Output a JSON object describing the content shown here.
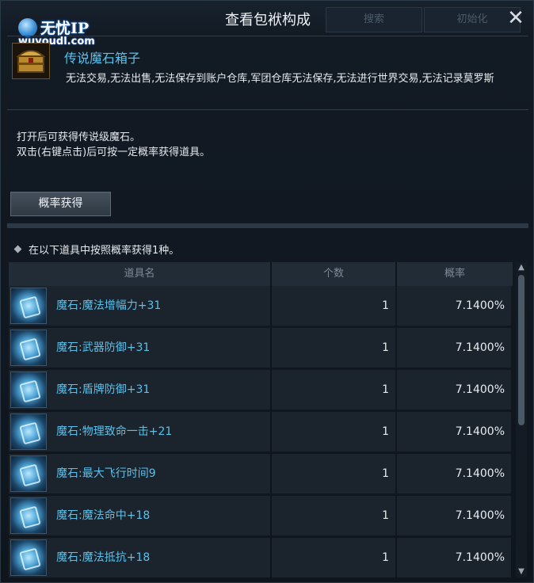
{
  "window": {
    "title": "查看包袱构成",
    "search_label": "搜索",
    "reset_label": "初始化",
    "close_label": "✕"
  },
  "watermark": {
    "brand": "无忧IP",
    "url": "wuyoudl.com"
  },
  "item": {
    "name": "传说魔石箱子",
    "restrictions": "无法交易,无法出售,无法保存到账户仓库,军团仓库无法保存,无法进行世界交易,无法记录莫罗斯",
    "icon": "treasure-chest-icon"
  },
  "description": {
    "line1": "打开后可获得传说级魔石。",
    "line2": "双击(右键点击)后可按一定概率获得道具。"
  },
  "probability_button": "概率获得",
  "note": "在以下道具中按照概率获得1种。",
  "table": {
    "headers": [
      "道具名",
      "个数",
      "概率"
    ],
    "rows": [
      {
        "name": "魔石:魔法增幅力+31",
        "qty": "1",
        "rate": "7.1400%",
        "icon": "manastone-icon"
      },
      {
        "name": "魔石:武器防御+31",
        "qty": "1",
        "rate": "7.1400%",
        "icon": "manastone-icon"
      },
      {
        "name": "魔石:盾牌防御+31",
        "qty": "1",
        "rate": "7.1400%",
        "icon": "manastone-icon"
      },
      {
        "name": "魔石:物理致命一击+21",
        "qty": "1",
        "rate": "7.1400%",
        "icon": "manastone-icon"
      },
      {
        "name": "魔石:最大飞行时间9",
        "qty": "1",
        "rate": "7.1400%",
        "icon": "manastone-icon"
      },
      {
        "name": "魔石:魔法命中+18",
        "qty": "1",
        "rate": "7.1400%",
        "icon": "manastone-icon"
      },
      {
        "name": "魔石:魔法抵抗+18",
        "qty": "1",
        "rate": "7.1400%",
        "icon": "manastone-icon"
      }
    ]
  },
  "colors": {
    "item_name": "#54c3f1",
    "accent": "#59c1ec"
  }
}
